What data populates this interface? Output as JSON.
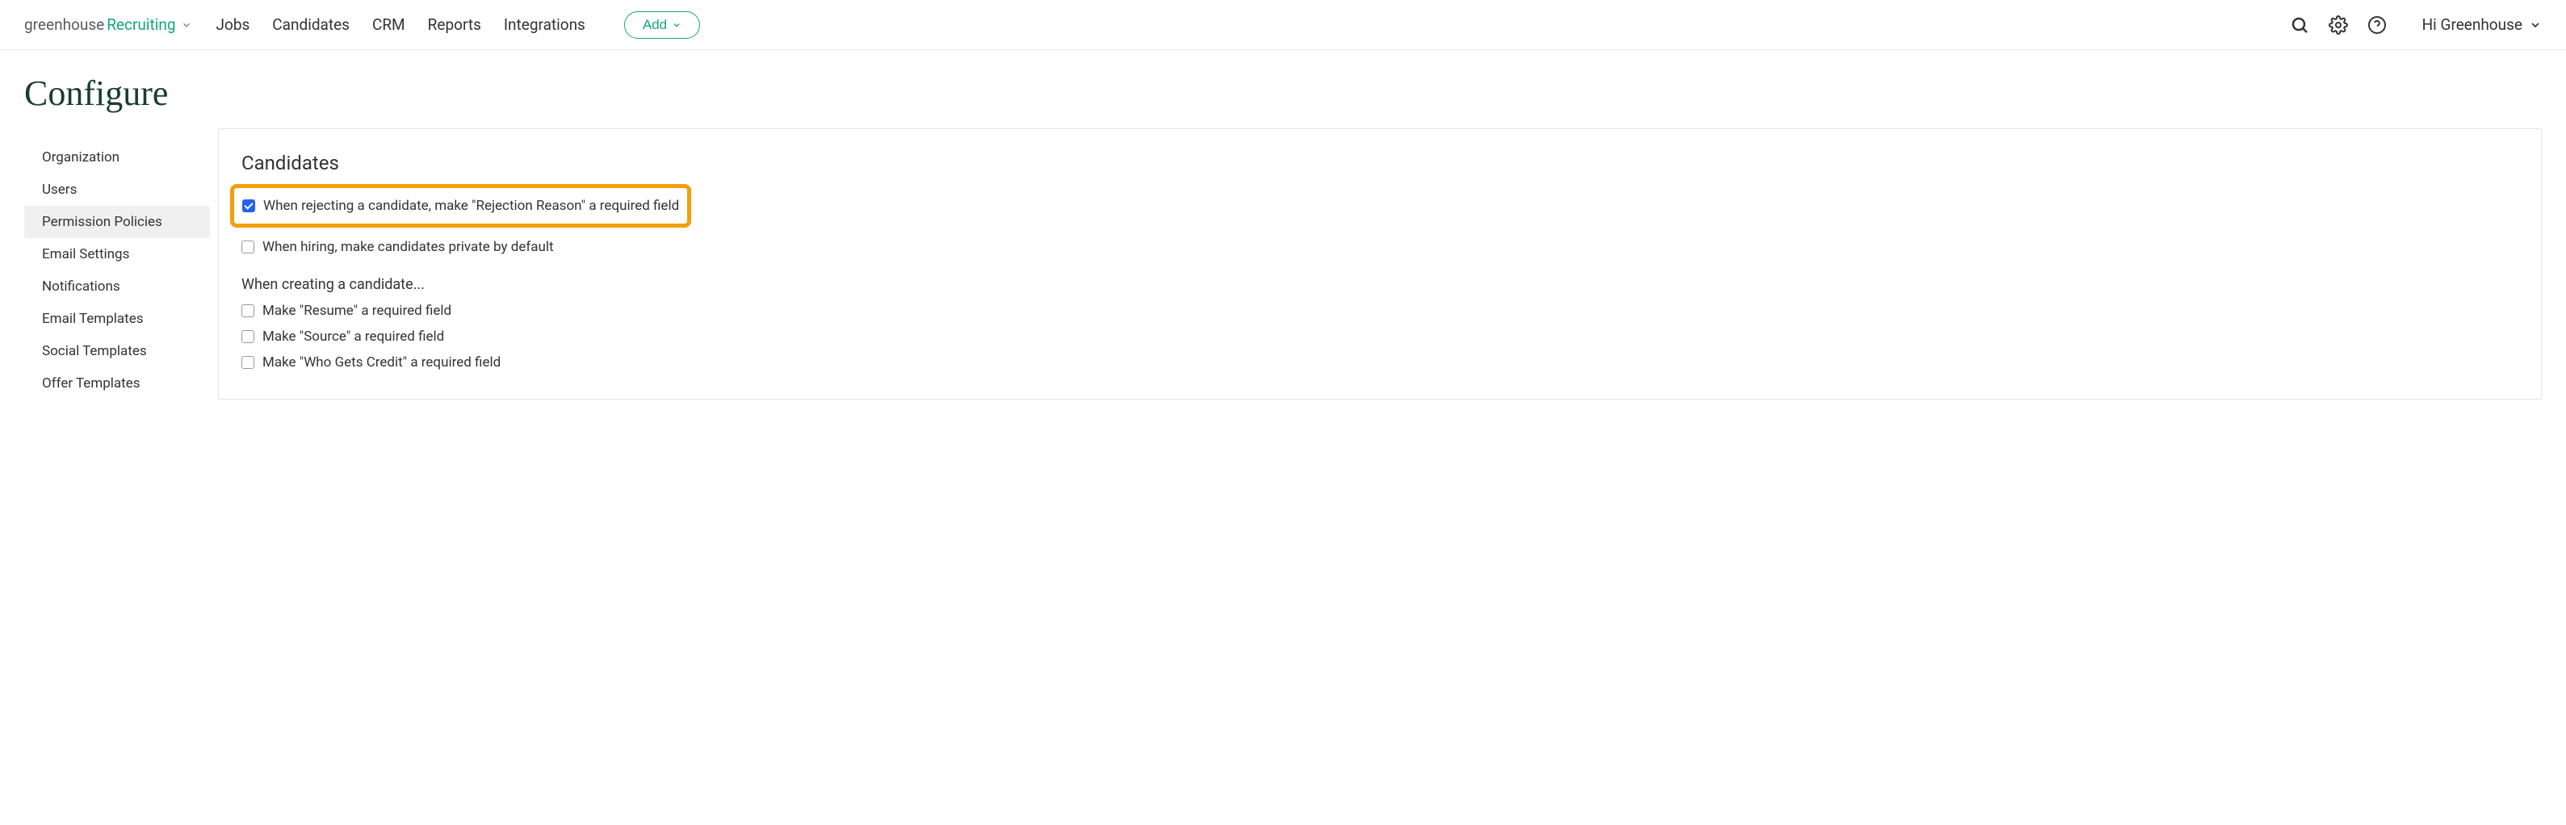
{
  "header": {
    "logo_primary": "greenhouse",
    "logo_secondary": "Recruiting",
    "nav": [
      "Jobs",
      "Candidates",
      "CRM",
      "Reports",
      "Integrations"
    ],
    "add_label": "Add",
    "user_greeting": "Hi Greenhouse"
  },
  "page": {
    "title": "Configure"
  },
  "sidebar": {
    "items": [
      {
        "label": "Organization",
        "active": false
      },
      {
        "label": "Users",
        "active": false
      },
      {
        "label": "Permission Policies",
        "active": true
      },
      {
        "label": "Email Settings",
        "active": false
      },
      {
        "label": "Notifications",
        "active": false
      },
      {
        "label": "Email Templates",
        "active": false
      },
      {
        "label": "Social Templates",
        "active": false
      },
      {
        "label": "Offer Templates",
        "active": false
      }
    ]
  },
  "main": {
    "section_title": "Candidates",
    "options": [
      {
        "label": "When rejecting a candidate, make \"Rejection Reason\" a required field",
        "checked": true,
        "highlighted": true
      },
      {
        "label": "When hiring, make candidates private by default",
        "checked": false,
        "highlighted": false
      }
    ],
    "subsection_title": "When creating a candidate...",
    "sub_options": [
      {
        "label": "Make \"Resume\" a required field",
        "checked": false
      },
      {
        "label": "Make \"Source\" a required field",
        "checked": false
      },
      {
        "label": "Make \"Who Gets Credit\" a required field",
        "checked": false
      }
    ]
  }
}
